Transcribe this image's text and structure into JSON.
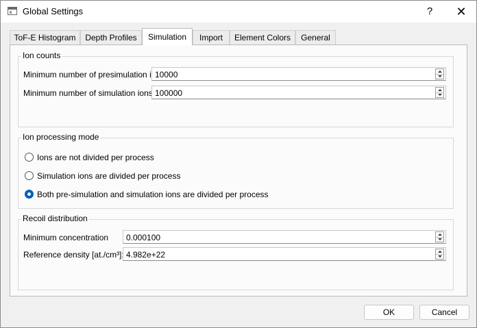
{
  "window": {
    "title": "Global Settings",
    "help_label": "?",
    "close_label": "✕"
  },
  "tabs": [
    {
      "label": "ToF-E Histogram"
    },
    {
      "label": "Depth Profiles"
    },
    {
      "label": "Simulation",
      "active": true
    },
    {
      "label": "Import"
    },
    {
      "label": "Element Colors"
    },
    {
      "label": "General"
    }
  ],
  "ion_counts": {
    "title": "Ion counts",
    "presim_label": "Minimum number of presimulation ions",
    "presim_value": "10000",
    "sim_label": "Minimum number of simulation ions",
    "sim_value": "100000"
  },
  "processing": {
    "title": "Ion processing mode",
    "options": [
      {
        "label": "Ions are not divided per process",
        "checked": false
      },
      {
        "label": "Simulation ions are divided per process",
        "checked": false
      },
      {
        "label": "Both pre-simulation and simulation ions are divided per process",
        "checked": true
      }
    ]
  },
  "recoil": {
    "title": "Recoil distribution",
    "min_conc_label": "Minimum concentration",
    "min_conc_value": "0.000100",
    "ref_density_label": "Reference density [at./cm³]:",
    "ref_density_value": "4.982e+22"
  },
  "buttons": {
    "ok": "OK",
    "cancel": "Cancel"
  },
  "colors": {
    "accent": "#005fb8",
    "window_bg": "#f0f0f0",
    "page_bg": "#fbfbfb"
  }
}
